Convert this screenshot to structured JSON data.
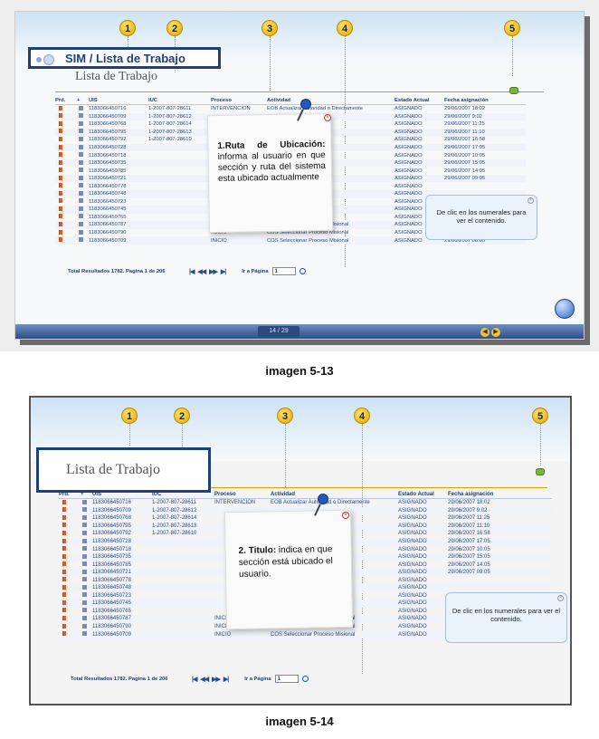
{
  "shot1": {
    "badges": [
      "1",
      "2",
      "3",
      "4",
      "5"
    ],
    "window_title": "SIM / Lista de Trabajo",
    "subtitle": "Lista de Trabajo",
    "table_headers": [
      "Prd.",
      "+",
      "UIS",
      "IUC",
      "Proceso",
      "Actividad",
      "Estado Actual",
      "Fecha asignación"
    ],
    "rows": [
      {
        "uis": "1183066450716",
        "iuc": "1-2007-807-28611",
        "proceso": "INTERVENCION",
        "actividad": "EOB Actualizar Autoridad o Directamente",
        "estado": "ASIGNADO",
        "fecha": "29/06/2007 18:02"
      },
      {
        "uis": "1183066450709",
        "iuc": "1-2007-807-28612",
        "proceso": "",
        "actividad": "",
        "estado": "ASIGNADO",
        "fecha": "29/06/2007 9:02"
      },
      {
        "uis": "1183066450768",
        "iuc": "1-2007-807-28614",
        "proceso": "",
        "actividad": "",
        "estado": "ASIGNADO",
        "fecha": "29/06/2007 11:25"
      },
      {
        "uis": "1183066450795",
        "iuc": "1-2007-807-28613",
        "proceso": "",
        "actividad": "",
        "estado": "ASIGNADO",
        "fecha": "29/06/2007 11:10"
      },
      {
        "uis": "1183066450792",
        "iuc": "1-2007-807-28610",
        "proceso": "",
        "actividad": "",
        "estado": "ASIGNADO",
        "fecha": "29/06/2007 16:58"
      },
      {
        "uis": "1183066450728",
        "iuc": "",
        "proceso": "",
        "actividad": "Misional",
        "estado": "ASIGNADO",
        "fecha": "29/06/2007 17:05"
      },
      {
        "uis": "1183066450718",
        "iuc": "",
        "proceso": "",
        "actividad": "Misional",
        "estado": "ASIGNADO",
        "fecha": "29/06/2007 10:05"
      },
      {
        "uis": "1183066450735",
        "iuc": "",
        "proceso": "",
        "actividad": "Misional",
        "estado": "ASIGNADO",
        "fecha": "29/06/2007 15:05"
      },
      {
        "uis": "1183066450785",
        "iuc": "",
        "proceso": "",
        "actividad": "Misional",
        "estado": "ASIGNADO",
        "fecha": "29/06/2007 14:05"
      },
      {
        "uis": "1183066450721",
        "iuc": "",
        "proceso": "",
        "actividad": "Misional",
        "estado": "ASIGNADO",
        "fecha": "29/06/2007 09:05"
      },
      {
        "uis": "1183066450778",
        "iuc": "",
        "proceso": "",
        "actividad": "",
        "estado": "ASIGNADO",
        "fecha": ""
      },
      {
        "uis": "1183066450748",
        "iuc": "",
        "proceso": "",
        "actividad": "",
        "estado": "ASIGNADO",
        "fecha": ""
      },
      {
        "uis": "1183066450723",
        "iuc": "",
        "proceso": "",
        "actividad": "",
        "estado": "ASIGNADO",
        "fecha": ""
      },
      {
        "uis": "1183066450745",
        "iuc": "",
        "proceso": "",
        "actividad": "",
        "estado": "ASIGNADO",
        "fecha": ""
      },
      {
        "uis": "1183066450765",
        "iuc": "",
        "proceso": "",
        "actividad": "",
        "estado": "ASIGNADO",
        "fecha": ""
      },
      {
        "uis": "1183066450787",
        "iuc": "",
        "proceso": "INICIO",
        "actividad": "COS Seleccionar Proceso Misional",
        "estado": "ASIGNADO",
        "fecha": ""
      },
      {
        "uis": "1183066450790",
        "iuc": "",
        "proceso": "INICIO",
        "actividad": "COS Seleccionar Proceso Misional",
        "estado": "ASIGNADO",
        "fecha": "29/06/2007 06:05"
      },
      {
        "uis": "1183066450709",
        "iuc": "",
        "proceso": "INICIO",
        "actividad": "COS Seleccionar Proceso Misional",
        "estado": "ASIGNADO",
        "fecha": "29/06/2007 08:05"
      }
    ],
    "total_text": "Total Resultados 1782. Pagina 1 de 206",
    "goto_label": "Ir a Página",
    "goto_value": "1",
    "note_heading": "1.Ruta de Ubicación:",
    "note_body": "informa al usuario en que sección y ruta del sistema esta ubicado actualmente",
    "bubble_text": "De clic en los numerales para ver el contenido.",
    "page_indicator": "14 / 29",
    "caption": "imagen 5-13"
  },
  "shot2": {
    "badges": [
      "1",
      "2",
      "3",
      "4",
      "5"
    ],
    "subtitle": "Lista de Trabajo",
    "table_headers": [
      "Prd.",
      "+",
      "UIS",
      "IUC",
      "Proceso",
      "Actividad",
      "Estado Actual",
      "Fecha asignación"
    ],
    "rows": [
      {
        "uis": "1183066450716",
        "iuc": "1-2007-807-28611",
        "proceso": "INTERVENCION",
        "actividad": "EOB Actualizar Autoridad o Directamente",
        "estado": "ASIGNADO",
        "fecha": "29/06/2007 18:02"
      },
      {
        "uis": "1183066450709",
        "iuc": "1-2007-807-28612",
        "proceso": "",
        "actividad": "",
        "estado": "ASIGNADO",
        "fecha": "29/06/2007 9:02"
      },
      {
        "uis": "1183066450768",
        "iuc": "1-2007-807-28614",
        "proceso": "",
        "actividad": "",
        "estado": "ASIGNADO",
        "fecha": "29/06/2007 11:25"
      },
      {
        "uis": "1183066450795",
        "iuc": "1-2007-807-28613",
        "proceso": "",
        "actividad": "",
        "estado": "ASIGNADO",
        "fecha": "29/06/2007 11:10"
      },
      {
        "uis": "1183066450792",
        "iuc": "1-2007-807-28610",
        "proceso": "",
        "actividad": "",
        "estado": "ASIGNADO",
        "fecha": "29/06/2007 16:58"
      },
      {
        "uis": "1183066450728",
        "iuc": "",
        "proceso": "",
        "actividad": "Misional",
        "estado": "ASIGNADO",
        "fecha": "29/06/2007 17:05"
      },
      {
        "uis": "1183066450718",
        "iuc": "",
        "proceso": "",
        "actividad": "Misional",
        "estado": "ASIGNADO",
        "fecha": "29/06/2007 10:05"
      },
      {
        "uis": "1183066450735",
        "iuc": "",
        "proceso": "",
        "actividad": "Misional",
        "estado": "ASIGNADO",
        "fecha": "29/06/2007 15:05"
      },
      {
        "uis": "1183066450785",
        "iuc": "",
        "proceso": "",
        "actividad": "Misional",
        "estado": "ASIGNADO",
        "fecha": "29/06/2007 14:05"
      },
      {
        "uis": "1183066450721",
        "iuc": "",
        "proceso": "",
        "actividad": "Misional",
        "estado": "ASIGNADO",
        "fecha": "29/06/2007 09:05"
      },
      {
        "uis": "1183066450778",
        "iuc": "",
        "proceso": "",
        "actividad": "",
        "estado": "ASIGNADO",
        "fecha": ""
      },
      {
        "uis": "1183066450748",
        "iuc": "",
        "proceso": "",
        "actividad": "",
        "estado": "ASIGNADO",
        "fecha": ""
      },
      {
        "uis": "1183066450723",
        "iuc": "",
        "proceso": "",
        "actividad": "",
        "estado": "ASIGNADO",
        "fecha": ""
      },
      {
        "uis": "1183066450745",
        "iuc": "",
        "proceso": "",
        "actividad": "",
        "estado": "ASIGNADO",
        "fecha": ""
      },
      {
        "uis": "1183066450765",
        "iuc": "",
        "proceso": "",
        "actividad": "",
        "estado": "ASIGNADO",
        "fecha": ""
      },
      {
        "uis": "1183066450787",
        "iuc": "",
        "proceso": "INICIO",
        "actividad": "COS Seleccionar Proceso Misional",
        "estado": "ASIGNADO",
        "fecha": ""
      },
      {
        "uis": "1183066450790",
        "iuc": "",
        "proceso": "INICIO",
        "actividad": "COS Seleccionar Proceso Misional",
        "estado": "ASIGNADO",
        "fecha": "29/06/2007 06:05"
      },
      {
        "uis": "1183066450709",
        "iuc": "",
        "proceso": "INICIO",
        "actividad": "COS Seleccionar Proceso Misional",
        "estado": "ASIGNADO",
        "fecha": "29/06/2007 08:05"
      }
    ],
    "total_text": "Total Resultados 1782. Pagina 1 de 206",
    "goto_label": "Ir a Página",
    "goto_value": "1",
    "note_heading": "2. Titulo:",
    "note_body": "indica en que sección está ubicado el usuario.",
    "bubble_text": "De clic en los numerales para ver el contenido.",
    "caption": "imagen 5-14"
  },
  "colors": {
    "accent": "#1f3f7a",
    "badge": "#f1c232",
    "status": "#2a4a8a"
  }
}
